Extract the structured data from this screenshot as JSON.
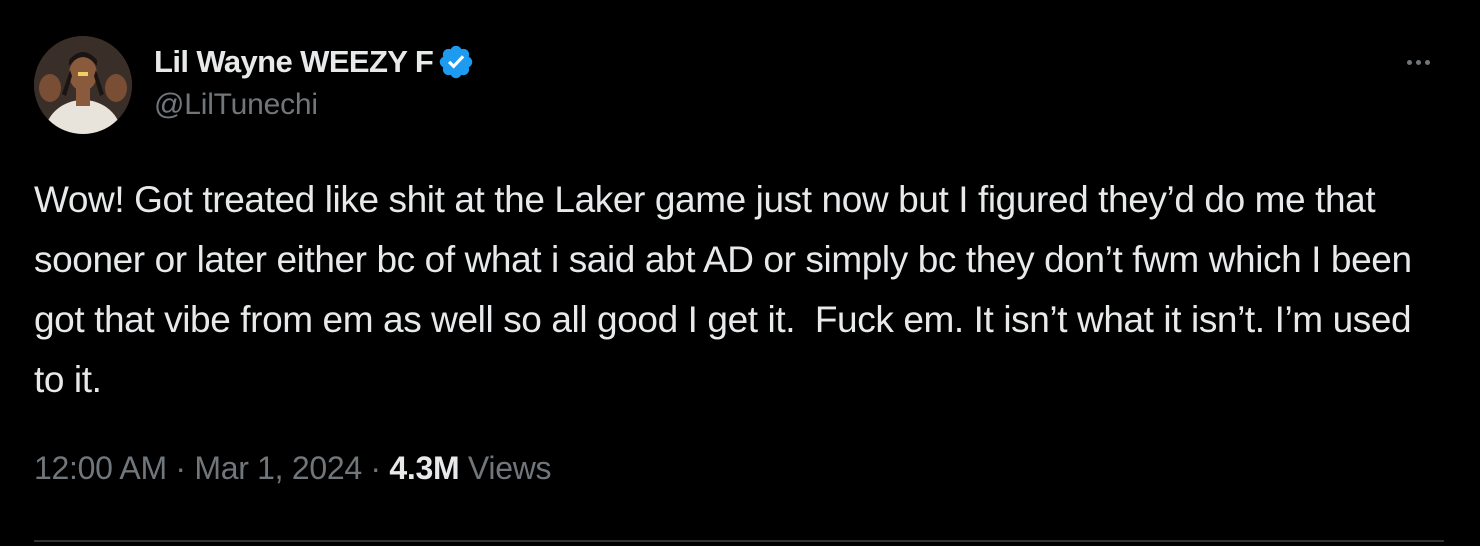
{
  "author": {
    "display_name": "Lil Wayne WEEZY F",
    "handle": "@LilTunechi",
    "verified": true,
    "verified_badge_color": "#1d9bf0"
  },
  "tweet": {
    "text": "Wow! Got treated like shit at the Laker game just now but I figured they’d do me that sooner or later either bc of what i said abt AD or simply bc they don’t fwm which I been got that vibe from em as well so all good I get it.  Fuck em. It isn’t what it isn’t. I’m used to it.",
    "time": "12:00 AM",
    "separator": "·",
    "date": "Mar 1, 2024",
    "views_count": "4.3M",
    "views_label": "Views"
  },
  "icons": {
    "more": "more-horizontal-icon",
    "verified": "verified-badge-icon"
  },
  "colors": {
    "background": "#000000",
    "primary_text": "#e7e9ea",
    "secondary_text": "#71767b",
    "divider": "#2f3336"
  }
}
